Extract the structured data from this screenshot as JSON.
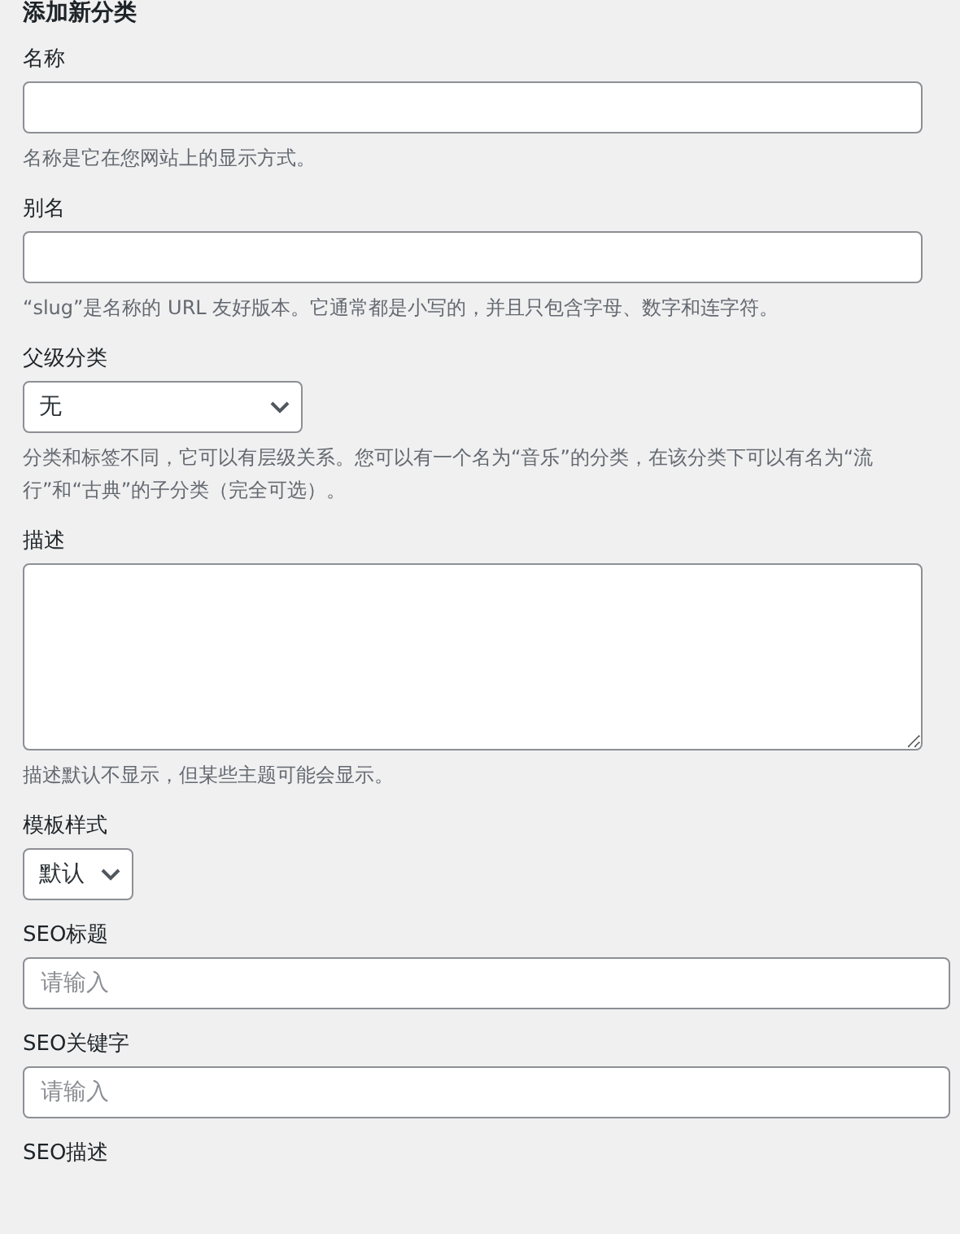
{
  "heading": "添加新分类",
  "fields": [
    {
      "kind": "text",
      "label": "名称",
      "help": "名称是它在您网站上的显示方式。"
    },
    {
      "kind": "text",
      "label": "别名",
      "help": "“slug”是名称的 URL 友好版本。它通常都是小写的，并且只包含字母、数字和连字符。"
    },
    {
      "kind": "select",
      "label": "父级分类",
      "value": "无",
      "help": "分类和标签不同，它可以有层级关系。您可以有一个名为“音乐”的分类，在该分类下可以有名为“流行”和“古典”的子分类（完全可选）。"
    },
    {
      "kind": "textarea",
      "label": "描述",
      "help": "描述默认不显示，但某些主题可能会显示。"
    },
    {
      "kind": "select",
      "label": "模板样式",
      "value": "默认"
    },
    {
      "kind": "text",
      "label": "SEO标题",
      "placeholder": "请输入"
    },
    {
      "kind": "text",
      "label": "SEO关键字",
      "placeholder": "请输入"
    },
    {
      "kind": "label",
      "label": "SEO描述"
    }
  ]
}
